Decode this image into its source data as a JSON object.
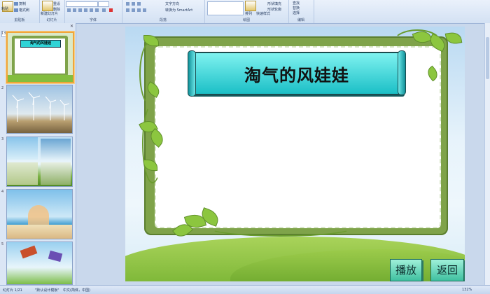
{
  "ribbon": {
    "clipboard": {
      "paste": "粘贴",
      "copy": "复制",
      "format_painter": "格式刷",
      "label": "剪贴板"
    },
    "slides": {
      "new_slide": "新建幻灯片",
      "reset": "重设",
      "delete": "删除",
      "label": "幻灯片"
    },
    "font": {
      "label": "字体"
    },
    "paragraph": {
      "text_direction": "文字方向",
      "convert_smartart": "转换为 SmartArt",
      "label": "段落"
    },
    "drawing": {
      "arrange": "排列",
      "quick_styles": "快速样式",
      "shape_fill": "形状填充",
      "shape_outline": "形状轮廓",
      "label": "绘图"
    },
    "editing": {
      "find": "查找",
      "replace": "替换",
      "select": "选择",
      "label": "编辑"
    }
  },
  "panel": {
    "tabs": [
      "幻灯片",
      "大纲"
    ],
    "slide_numbers": [
      "1",
      "2",
      "3",
      "4",
      "5"
    ],
    "thumb1_title": "淘气的风娃娃"
  },
  "slide": {
    "title": "淘气的风娃娃",
    "play_button": "播放",
    "back_button": "返回"
  },
  "status": {
    "slide_info": "幻灯片 1/21",
    "theme": "\"默认设计模板\"",
    "language": "中文(简体，中国)",
    "zoom": "132%"
  }
}
